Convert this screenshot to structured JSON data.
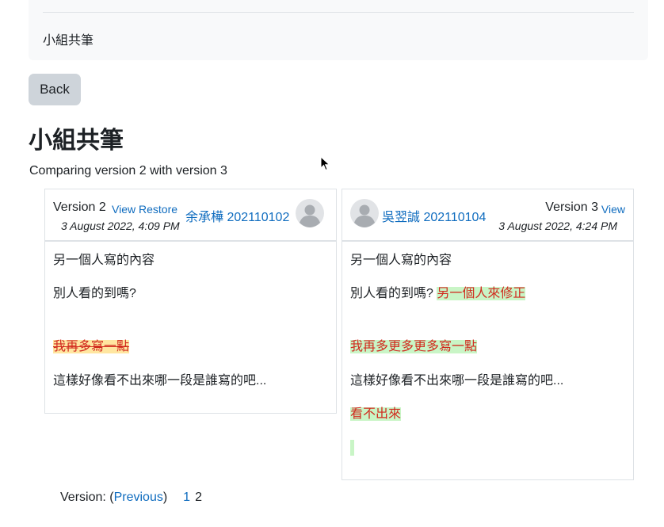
{
  "breadcrumb": {
    "current": "小組共筆"
  },
  "back_button": "Back",
  "page": {
    "title": "小組共筆",
    "subtitle": "Comparing version 2 with version 3"
  },
  "compare": {
    "left": {
      "version_label": "Version 2",
      "view_link": "View",
      "restore_link": "Restore",
      "author": "余承樺 202110102",
      "date": "3 August 2022, 4:09 PM",
      "paragraphs": {
        "p1": "另一個人寫的內容",
        "p2": "別人看的到嗎?",
        "p3_deleted": "我再多寫一點",
        "p4": "這樣好像看不出來哪一段是誰寫的吧..."
      }
    },
    "right": {
      "version_label": "Version 3",
      "view_link": "View",
      "author": "吳翌誠 202110104",
      "date": "3 August 2022, 4:24 PM",
      "paragraphs": {
        "p1": "另一個人寫的內容",
        "p2": "別人看的到嗎?",
        "p2_inserted": "另一個人來修正",
        "p3_inserted": "我再多更多更多寫一點",
        "p4": "這樣好像看不出來哪一段是誰寫的吧...",
        "p5_inserted": "看不出來"
      }
    }
  },
  "pager": {
    "prefix": "Version: (",
    "previous": "Previous",
    "suffix": ")",
    "page1": "1",
    "page2": "2"
  },
  "colors": {
    "link": "#0f6cbf",
    "inserted_bg": "#c9f5c6",
    "deleted_bg": "#ffe6a0",
    "diff_text": "#d12a1e"
  }
}
